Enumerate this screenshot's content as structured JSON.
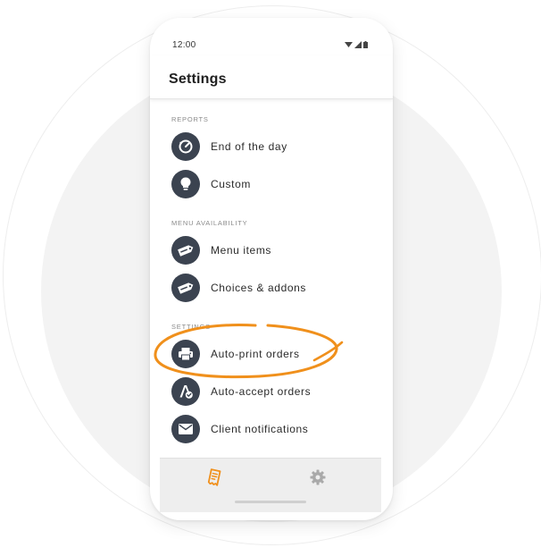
{
  "status_bar": {
    "time": "12:00",
    "icons": [
      "wifi-icon",
      "signal-icon",
      "battery-icon"
    ]
  },
  "header": {
    "title": "Settings"
  },
  "sections": [
    {
      "title": "REPORTS",
      "items": [
        {
          "label": "End of the day",
          "icon": "report-clock-icon"
        },
        {
          "label": "Custom",
          "icon": "lightbulb-icon"
        }
      ]
    },
    {
      "title": "MENU AVAILABILITY",
      "items": [
        {
          "label": "Menu items",
          "icon": "tag-icon"
        },
        {
          "label": "Choices & addons",
          "icon": "tag-icon"
        }
      ]
    },
    {
      "title": "SETTINGS",
      "items": [
        {
          "label": "Auto-print orders",
          "icon": "printer-icon"
        },
        {
          "label": "Auto-accept orders",
          "icon": "auto-accept-icon"
        },
        {
          "label": "Client notifications",
          "icon": "envelope-icon"
        }
      ]
    }
  ],
  "bottom_nav": {
    "tabs": [
      {
        "icon": "orders-receipt-icon",
        "active": true
      },
      {
        "icon": "gear-icon",
        "active": false
      }
    ]
  },
  "colors": {
    "icon_circle": "#3b4350",
    "accent": "#f0901c",
    "inactive_tab": "#a9a9a9",
    "halo": "#f3f3f3"
  }
}
